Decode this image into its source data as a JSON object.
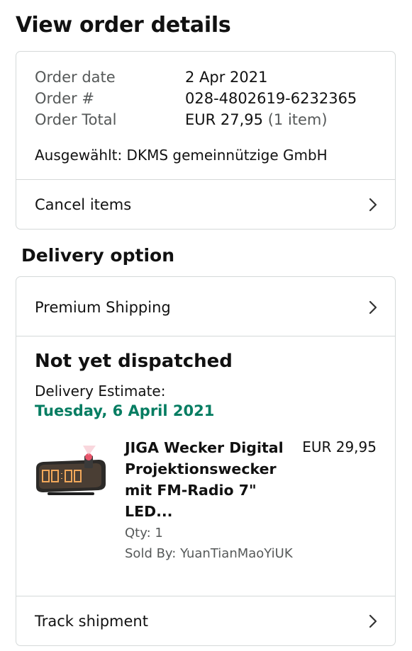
{
  "page": {
    "title": "View order details"
  },
  "order": {
    "date_label": "Order date",
    "date_value": "2 Apr 2021",
    "number_label": "Order #",
    "number_value": "028-4802619-6232365",
    "total_label": "Order Total",
    "total_value": "EUR 27,95",
    "total_items": "(1 item)",
    "selected_text": "Ausgewählt: DKMS gemeinnützige GmbH",
    "cancel_label": "Cancel items"
  },
  "delivery": {
    "section_title": "Delivery option",
    "shipping_option": "Premium Shipping",
    "status": "Not yet dispatched",
    "estimate_label": "Delivery Estimate:",
    "estimate_date": "Tuesday, 6 April 2021",
    "track_label": "Track shipment"
  },
  "product": {
    "title": "JIGA Wecker Digital Projektionswecker mit FM-Radio 7\" LED...",
    "price": "EUR 29,95",
    "qty": "Qty: 1",
    "seller": "Sold By: YuanTianMaoYiUK",
    "image_icon": "projection-alarm-clock-image"
  },
  "icons": {
    "chevron": "chevron-right-icon"
  },
  "colors": {
    "accent_green": "#067d62",
    "muted_text": "#565959",
    "border": "#d5d9d9"
  }
}
